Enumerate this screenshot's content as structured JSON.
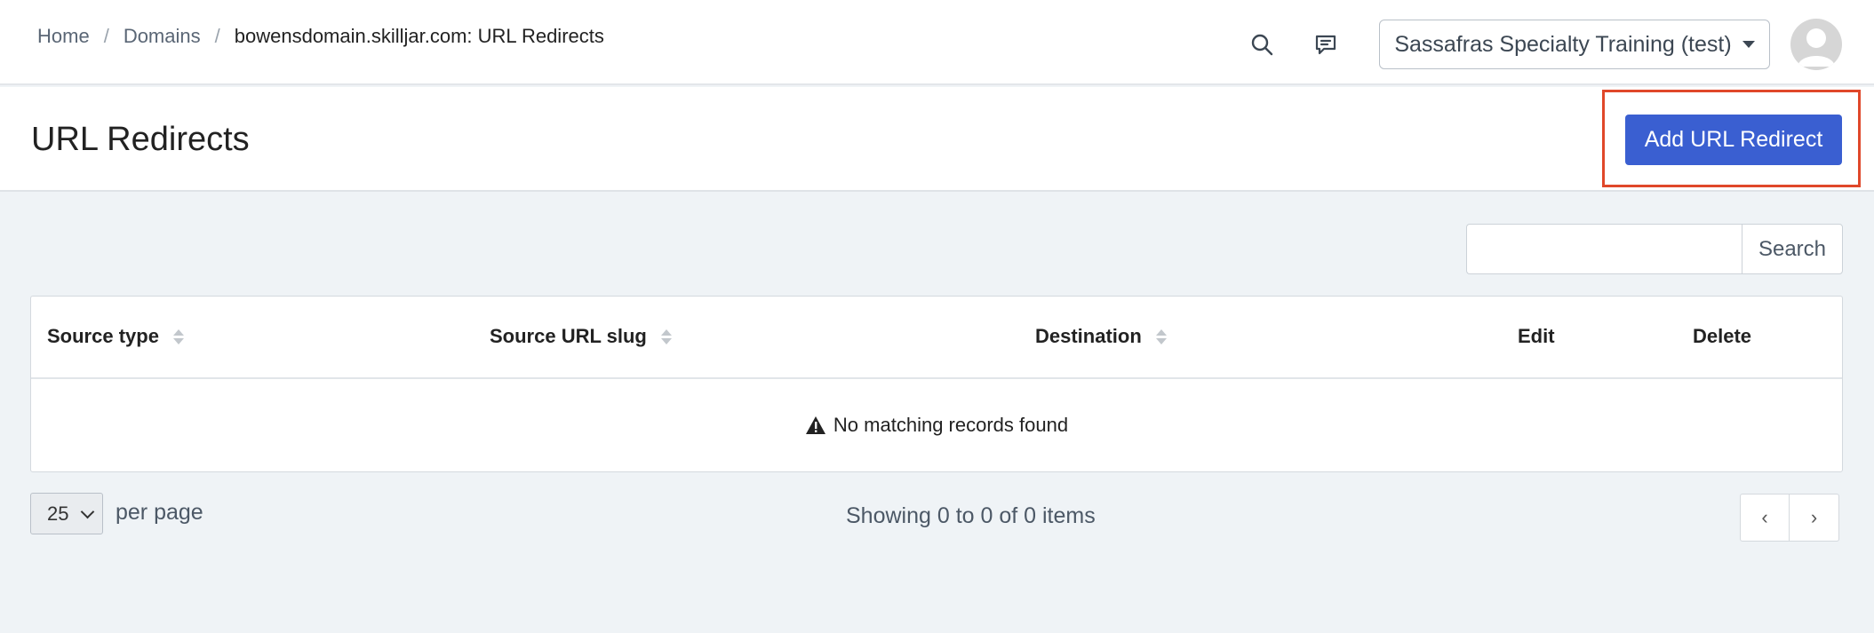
{
  "breadcrumb": {
    "home": "Home",
    "separator": "/",
    "domains": "Domains",
    "current": "bowensdomain.skilljar.com: URL Redirects"
  },
  "topbar": {
    "search_icon": "search-icon",
    "feedback_icon": "chat-icon",
    "organization": "Sassafras Specialty Training (test)",
    "avatar_icon": "user-avatar"
  },
  "header": {
    "title": "URL Redirects",
    "add_button": "Add URL Redirect"
  },
  "search": {
    "value": "",
    "placeholder": "",
    "button": "Search"
  },
  "table": {
    "columns": {
      "source_type": "Source type",
      "source_url_slug": "Source URL slug",
      "destination": "Destination",
      "edit": "Edit",
      "delete": "Delete"
    },
    "empty_message": "No matching records found"
  },
  "pagination": {
    "per_page_value": "25",
    "per_page_label": "per page",
    "showing": "Showing 0 to 0 of 0 items",
    "prev": "‹",
    "next": "›"
  },
  "colors": {
    "accent": "#3a5fd1",
    "highlight": "#e0482a",
    "background": "#eff3f6"
  }
}
